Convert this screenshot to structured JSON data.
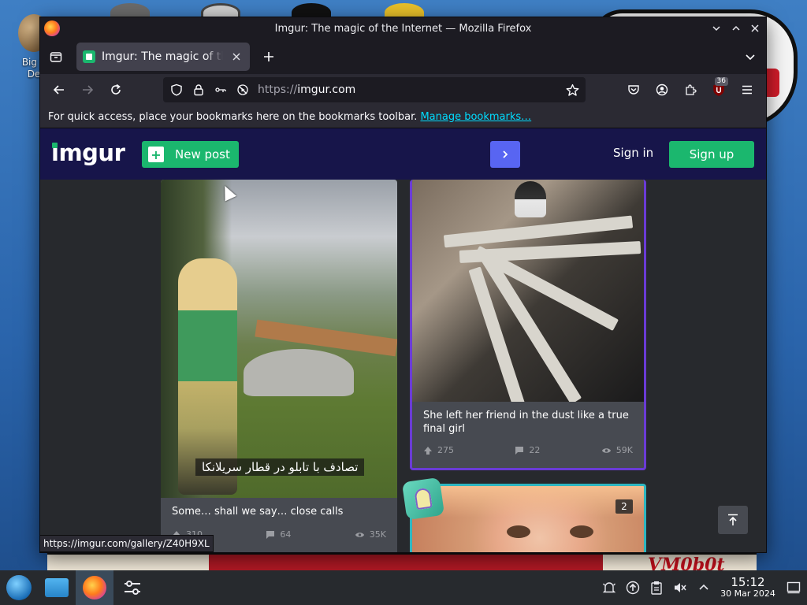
{
  "desktop": {
    "icon_label": "Big T\nDe",
    "wall_sign": "VM0b0t"
  },
  "window": {
    "title": "Imgur: The magic of the Internet — Mozilla Firefox"
  },
  "tabs": [
    {
      "title": "Imgur: The magic of the Internet",
      "active": true
    }
  ],
  "navbar": {
    "url_scheme": "https://",
    "url_host": "imgur.com",
    "ublock_count": "36"
  },
  "bookmarks_bar": {
    "message": "For quick access, place your bookmarks here on the bookmarks toolbar.",
    "link": "Manage bookmarks…"
  },
  "imgur": {
    "logo": "imgur",
    "new_post": "New post",
    "sign_in": "Sign in",
    "sign_up": "Sign up",
    "posts": [
      {
        "title": "Some… shall we say… close calls",
        "overlay_caption": "تصادف با تابلو در قطار سریلانکا",
        "upvotes": "310",
        "comments": "64",
        "views": "35K"
      },
      {
        "title": "She left her friend in the dust like a true final girl",
        "upvotes": "275",
        "comments": "22",
        "views": "59K"
      },
      {
        "image_count": "2"
      }
    ]
  },
  "status_bar": {
    "url": "https://imgur.com/gallery/Z40H9XL"
  },
  "taskbar": {
    "time": "15:12",
    "date": "30 Mar 2024"
  },
  "colors": {
    "imgur_green": "#1bb76e",
    "imgur_header": "#17154a",
    "accent_purple": "#5865f2",
    "card_bg": "#474a51",
    "page_bg": "#27292d",
    "link_cyan": "#00ddff"
  }
}
